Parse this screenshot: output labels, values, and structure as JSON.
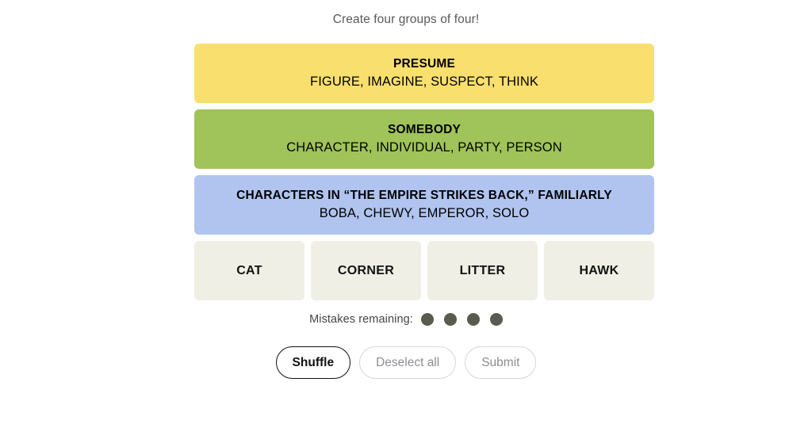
{
  "header": {
    "prompt": "Create four groups of four!"
  },
  "colors": {
    "yellow": "#f9df6d",
    "green": "#a0c35a",
    "blue": "#b0c4ef",
    "purple": "#ba81c5",
    "tile_background": "#efefe6",
    "mistake_dot": "#5a5b4e",
    "page_background": "#ffffff",
    "text_primary": "#121212",
    "text_muted": "#8e8e93"
  },
  "solved_groups": [
    {
      "color_name": "yellow",
      "color": "#f9df6d",
      "title": "PRESUME",
      "members_text": "FIGURE, IMAGINE, SUSPECT, THINK",
      "members": [
        "FIGURE",
        "IMAGINE",
        "SUSPECT",
        "THINK"
      ]
    },
    {
      "color_name": "green",
      "color": "#a0c35a",
      "title": "SOMEBODY",
      "members_text": "CHARACTER, INDIVIDUAL, PARTY, PERSON",
      "members": [
        "CHARACTER",
        "INDIVIDUAL",
        "PARTY",
        "PERSON"
      ]
    },
    {
      "color_name": "blue",
      "color": "#b0c4ef",
      "title": "CHARACTERS IN “THE EMPIRE STRIKES BACK,” FAMILIARLY",
      "members_text": "BOBA, CHEWY, EMPEROR, SOLO",
      "members": [
        "BOBA",
        "CHEWY",
        "EMPEROR",
        "SOLO"
      ]
    }
  ],
  "remaining_tiles": [
    {
      "label": "CAT"
    },
    {
      "label": "CORNER"
    },
    {
      "label": "LITTER"
    },
    {
      "label": "HAWK"
    }
  ],
  "mistakes": {
    "label": "Mistakes remaining:",
    "remaining": 4,
    "total": 4
  },
  "controls": {
    "shuffle_label": "Shuffle",
    "deselect_label": "Deselect all",
    "submit_label": "Submit",
    "shuffle_enabled": true,
    "deselect_enabled": false,
    "submit_enabled": false
  }
}
